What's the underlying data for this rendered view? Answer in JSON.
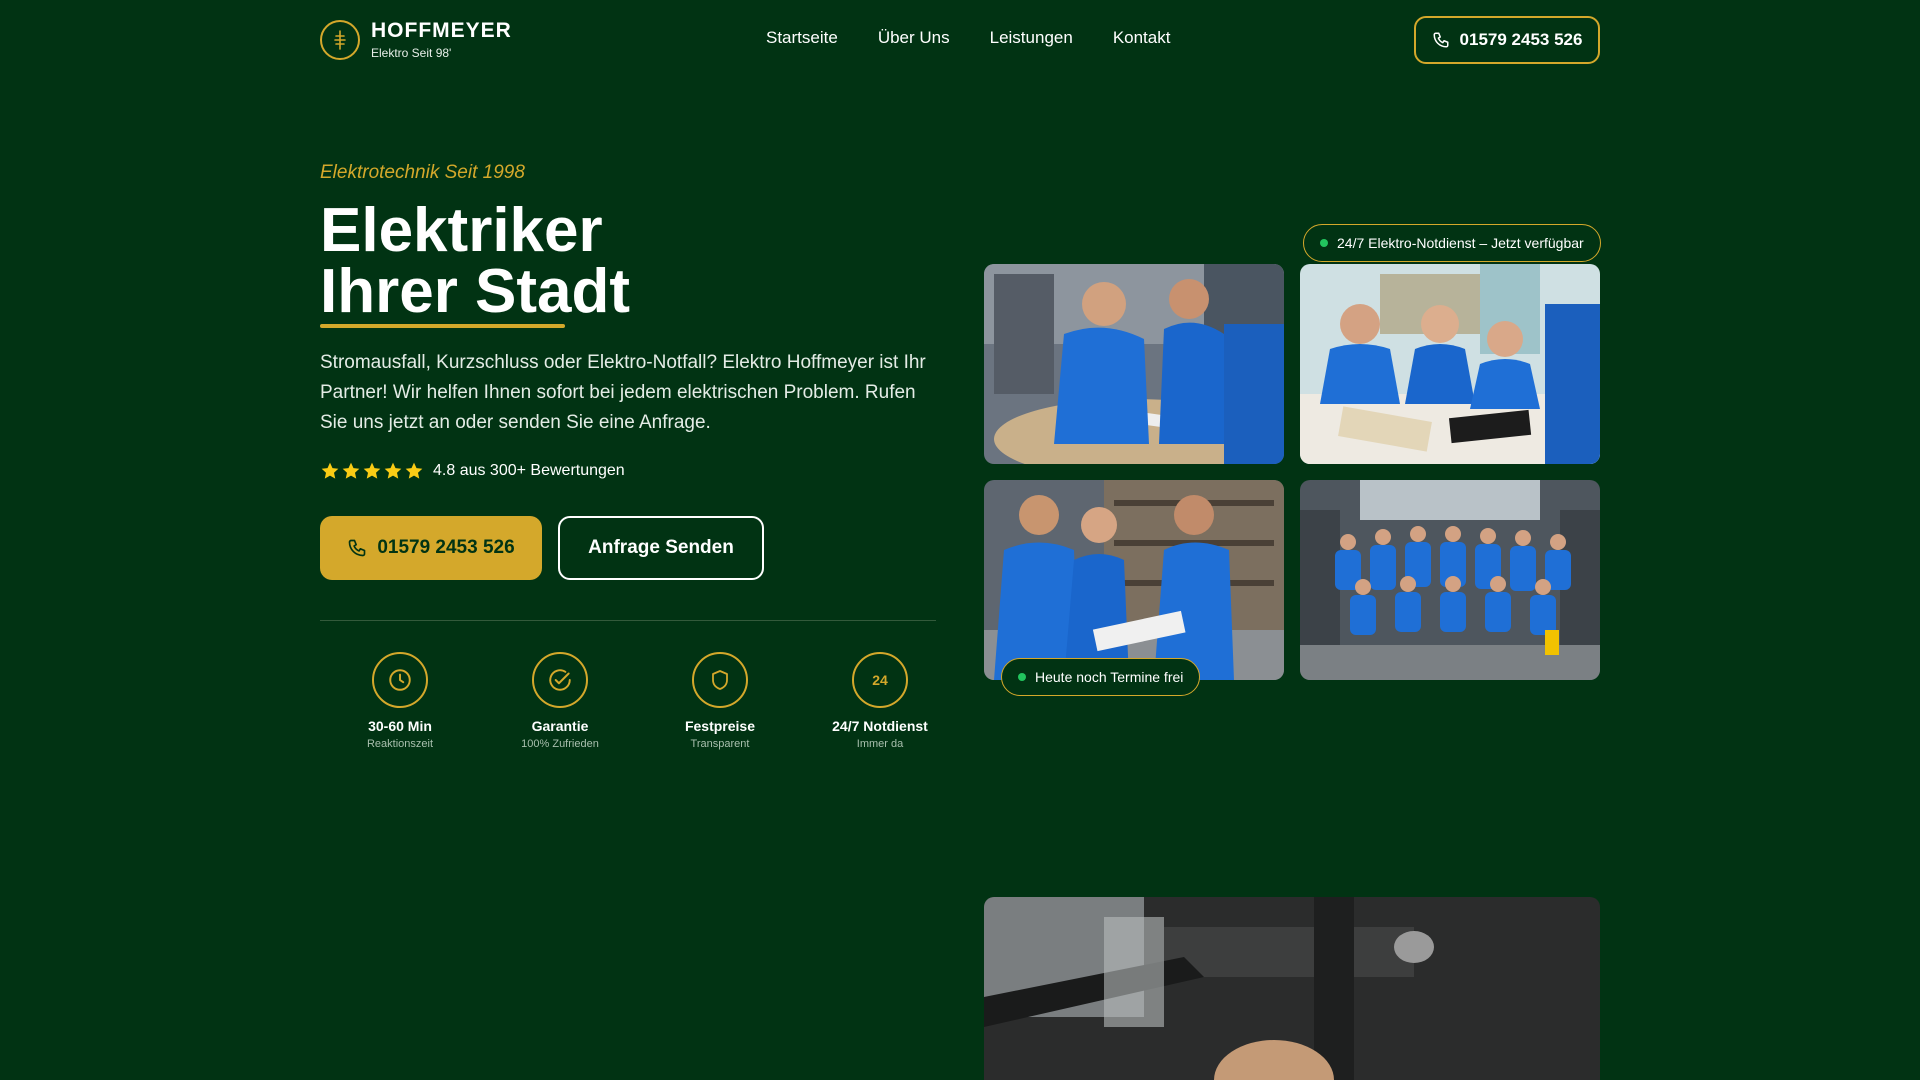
{
  "header": {
    "brand_name": "HOFFMEYER",
    "brand_sub": "Elektro Seit 98'",
    "nav": [
      "Startseite",
      "Über Uns",
      "Leistungen",
      "Kontakt"
    ],
    "phone": "01579 2453 526"
  },
  "hero": {
    "eyebrow": "Elektrotechnik Seit 1998",
    "headline_line1": "Elektriker",
    "headline_line2": "Ihrer Stadt",
    "lead": "Stromausfall, Kurzschluss oder Elektro-Notfall? Elektro Hoffmeyer ist Ihr Partner! Wir helfen Ihnen sofort bei jedem elektrischen Problem. Rufen Sie uns jetzt an oder senden Sie eine Anfrage.",
    "rating_text": "4.8 aus 300+ Bewertungen",
    "rating_stars": 5,
    "cta_phone": "01579 2453 526",
    "cta_request": "Anfrage Senden"
  },
  "features": [
    {
      "icon": "clock-icon",
      "title": "30-60 Min",
      "sub": "Reaktionszeit"
    },
    {
      "icon": "check-circle-icon",
      "title": "Garantie",
      "sub": "100% Zufrieden"
    },
    {
      "icon": "shield-icon",
      "title": "Festpreise",
      "sub": "Transparent"
    },
    {
      "icon": "24-icon",
      "icon_text": "24",
      "title": "24/7 Notdienst",
      "sub": "Immer da"
    }
  ],
  "badges": {
    "top": "24/7 Elektro-Notdienst – Jetzt verfügbar",
    "bottom": "Heute noch Termine frei"
  },
  "colors": {
    "background": "#013313",
    "accent": "#d4a82b",
    "status_dot": "#22c55e",
    "shirt_blue": "#1f6fd6"
  }
}
